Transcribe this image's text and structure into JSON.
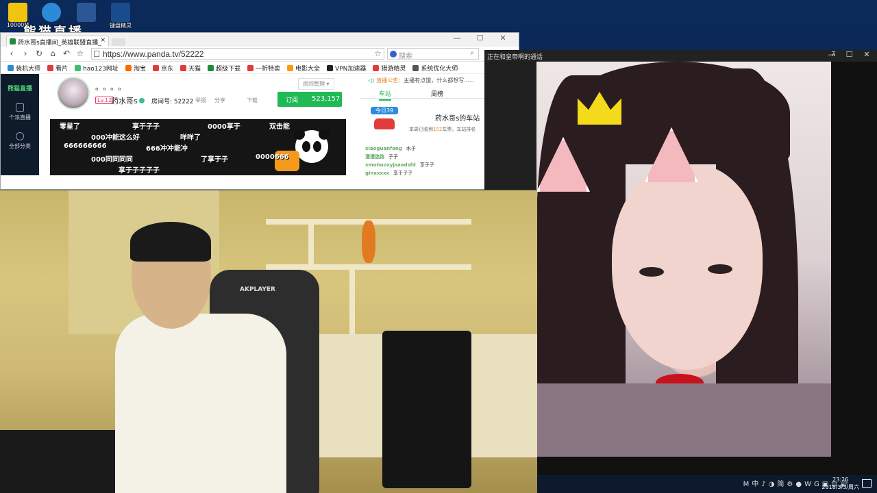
{
  "desktop": {
    "icons": [
      {
        "label": "10000M",
        "color": "#f1c40f"
      },
      {
        "label": "",
        "color": "#2b8bd8"
      },
      {
        "label": "",
        "color": "#2b5797"
      },
      {
        "label": "键盘精灵",
        "color": "#1a4b8c"
      }
    ],
    "watermark": "熊猫直播"
  },
  "browser": {
    "tab_title": "药水哥s直播间_英雄联盟直播_",
    "tab_close": "×",
    "window_buttons": [
      "—",
      "☐",
      "✕"
    ],
    "url": "https://www.panda.tv/52222",
    "search_placeholder": "搜索",
    "bookmarks": [
      {
        "label": "装机大师",
        "color": "#2b8bd8"
      },
      {
        "label": "看片",
        "color": "#e23b3b"
      },
      {
        "label": "hao123网址",
        "color": "#3bbf6e"
      },
      {
        "label": "淘宝",
        "color": "#ff6a00"
      },
      {
        "label": "京东",
        "color": "#e23b3b"
      },
      {
        "label": "天猫",
        "color": "#e23b3b"
      },
      {
        "label": "超级下载",
        "color": "#1e8c3a"
      },
      {
        "label": "一折特卖",
        "color": "#e23b3b"
      },
      {
        "label": "电影大全",
        "color": "#ff9a00"
      },
      {
        "label": "VPN加速器",
        "color": "#222222"
      },
      {
        "label": "猎游精灵",
        "color": "#e23b3b"
      },
      {
        "label": "系统优化大师",
        "color": "#555555"
      }
    ],
    "side_nav": {
      "logo": "熊猫直播",
      "items": [
        "个派直播",
        "全部分类"
      ]
    },
    "room": {
      "title": "。。。。",
      "level": "Lv.12",
      "anchor_name": "药水哥s",
      "room_id": "房间号: 52222",
      "report": "举报",
      "share": "分享",
      "download": "下载",
      "manage": "房间管理 ▾",
      "subscribe_label": "订阅",
      "subscribe_count": "523,157"
    },
    "danmu": [
      "零星了",
      "享于子子",
      "0000享于",
      "双击能",
      "000冲能这么好",
      "咩咩了",
      "666666666",
      "666冲冲能冲",
      "000同同同同",
      "了享于子",
      "0000666",
      "享于子子子子"
    ],
    "notice": {
      "label": "直播公告：",
      "text": "主播有点饿，什么都想写......"
    },
    "right_tabs": [
      "车站",
      "周榜"
    ],
    "car_today": "今日39",
    "car_station_title": "药水哥s的车站",
    "car_station_desc_prefix": "本周已收到",
    "car_station_desc_count": "152",
    "car_station_desc_suffix": "车票，车站排名",
    "chat": [
      {
        "user": "xiaoguanfang",
        "msg": "水子"
      },
      {
        "user": "漫漫迷路",
        "msg": "子子"
      },
      {
        "user": "xmohuoxyjsaadsfd",
        "msg": "享于子"
      },
      {
        "user": "ginxxxxx",
        "msg": "享于子子"
      }
    ]
  },
  "call": {
    "title": "正在和皇帝啊的通话",
    "pin": "⊼",
    "window_buttons": [
      "—",
      "☐",
      "✕"
    ]
  },
  "local_video": {
    "chair_brand": "AKPLAYER"
  },
  "taskbar": {
    "tray_icons": [
      "M",
      "中",
      "♪",
      "◑",
      "简",
      "⚙",
      "●",
      "W",
      "G",
      "▣",
      "⊡",
      "🔊"
    ],
    "time": "23:26",
    "date": "2018/3/3/周六"
  }
}
